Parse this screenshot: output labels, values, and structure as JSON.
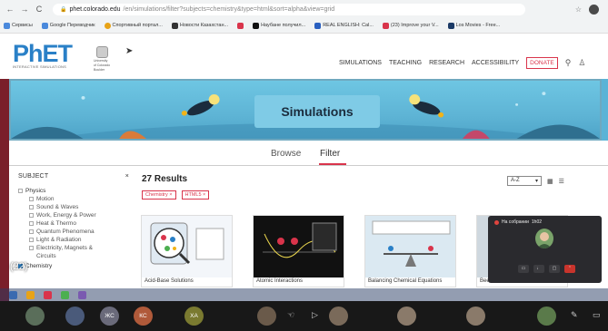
{
  "browser": {
    "back": "←",
    "forward": "→",
    "reload": "C",
    "url_host": "phet.colorado.edu",
    "url_path": "/en/simulations/filter?subjects=chemistry&type=html&sort=alpha&view=grid",
    "star_icon": "star-icon",
    "bookmarks": [
      {
        "label": "Сервисы",
        "color": "#4a89dc"
      },
      {
        "label": "Google Переводчик",
        "color": "#4a89dc"
      },
      {
        "label": "Спортивный портал...",
        "color": "#e8a317"
      },
      {
        "label": "Новости Казахстан...",
        "color": "#333333"
      },
      {
        "label": "",
        "color": "#d9344b"
      },
      {
        "label": "Наубане получил...",
        "color": "#111111"
      },
      {
        "label": "REAL ENGLISH: Cal...",
        "color": "#2a60c0"
      },
      {
        "label": "(23) Improve your V...",
        "color": "#d9344b"
      },
      {
        "label": "Los Movies - Free...",
        "color": "#1b3a66"
      }
    ]
  },
  "header": {
    "logo_main_a": "Ph",
    "logo_main_b": "ET",
    "logo_sub": "INTERACTIVE SIMULATIONS",
    "cu_text_1": "University",
    "cu_text_2": "of Colorado",
    "cu_text_3": "Boulder",
    "nav": [
      "SIMULATIONS",
      "TEACHING",
      "RESEARCH",
      "ACCESSIBILITY"
    ],
    "donate": "DONATE"
  },
  "banner": {
    "title": "Simulations"
  },
  "tabs": {
    "browse": "Browse",
    "filter": "Filter"
  },
  "sidebar": {
    "heading": "SUBJECT",
    "close": "×",
    "items": [
      {
        "label": "Physics",
        "sub": false
      },
      {
        "label": "Motion",
        "sub": true
      },
      {
        "label": "Sound & Waves",
        "sub": true
      },
      {
        "label": "Work, Energy & Power",
        "sub": true
      },
      {
        "label": "Heat & Thermo",
        "sub": true
      },
      {
        "label": "Quantum Phenomena",
        "sub": true
      },
      {
        "label": "Light & Radiation",
        "sub": true
      },
      {
        "label": "Electricity, Magnets &",
        "sub": true
      },
      {
        "label": "Circuits",
        "sub": true
      }
    ],
    "partial": "Chemistry"
  },
  "results": {
    "heading": "27 Results",
    "chips": [
      "Chemistry ×",
      "HTML5 ×"
    ],
    "sort_value": "A-Z",
    "cards": [
      {
        "title": "Acid-Base Solutions"
      },
      {
        "title": "Atomic Interactions"
      },
      {
        "title": "Balancing Chemical Equations"
      },
      {
        "title": "Beer's Law Lab"
      }
    ]
  },
  "meeting": {
    "title": "На собрании",
    "time": "1h02"
  },
  "overlay_count": "(22)",
  "participants": [
    {
      "initials": "",
      "color": "#5a6e5a"
    },
    {
      "initials": "",
      "color": "#4a5a7a"
    },
    {
      "initials": "ЖС",
      "color": "#6a6a7a"
    },
    {
      "initials": "КС",
      "color": "#b05a3a"
    },
    {
      "initials": "ХА",
      "color": "#7a7a30"
    },
    {
      "initials": "",
      "color": "#6a5a4a"
    },
    {
      "initials": "",
      "color": "#7a6a5a"
    },
    {
      "initials": "",
      "color": "#8a7a6a"
    },
    {
      "initials": "",
      "color": "#5a7a4a"
    }
  ]
}
